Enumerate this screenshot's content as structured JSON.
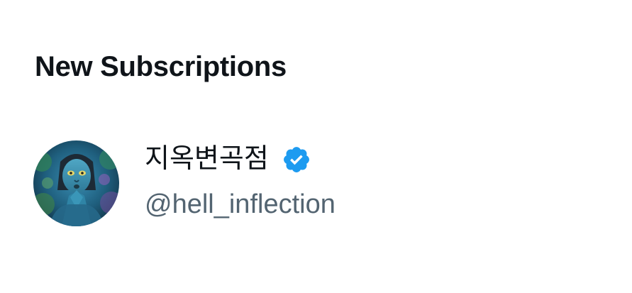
{
  "section": {
    "title": "New Subscriptions"
  },
  "subscription": {
    "display_name": "지옥변곡점",
    "handle": "@hell_inflection",
    "verified": true,
    "verified_icon": "verified-badge-icon",
    "avatar_icon": "avatar-image"
  },
  "colors": {
    "primary_text": "#0f1419",
    "secondary_text": "#536471",
    "verified_blue": "#1d9bf0",
    "background": "#ffffff"
  }
}
